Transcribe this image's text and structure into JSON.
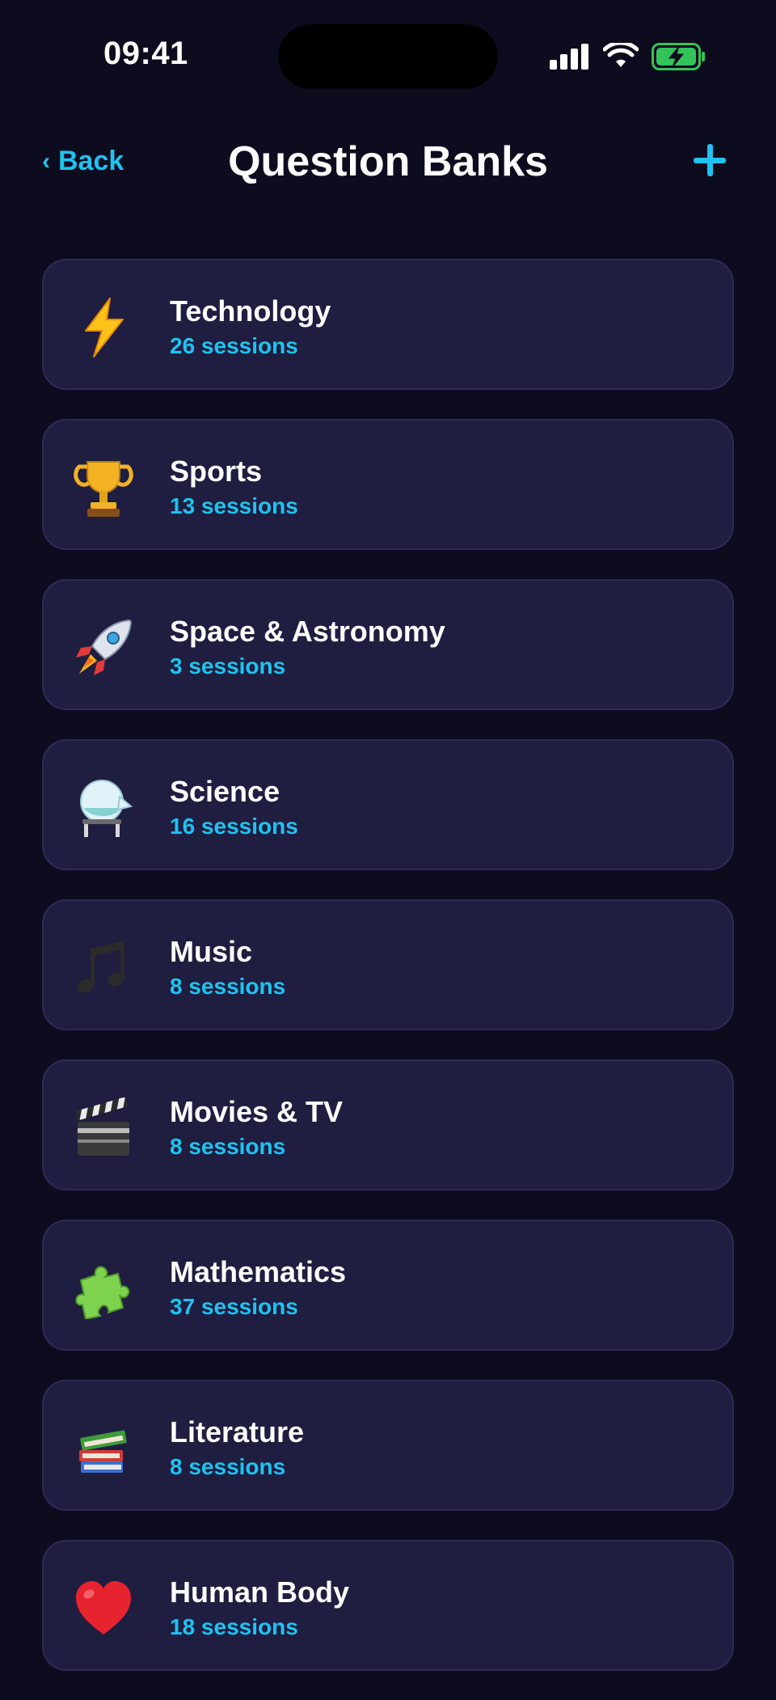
{
  "status_bar": {
    "time": "09:41"
  },
  "nav": {
    "back_label": "Back",
    "title": "Question Banks",
    "add_icon": "plus-icon"
  },
  "colors": {
    "background": "#0d0c1f",
    "card": "#1f1e40",
    "accent": "#1ec3f0"
  },
  "categories": [
    {
      "icon": "lightning-icon",
      "title": "Technology",
      "subtitle": "26 sessions"
    },
    {
      "icon": "trophy-icon",
      "title": "Sports",
      "subtitle": "13 sessions"
    },
    {
      "icon": "rocket-icon",
      "title": "Space & Astronomy",
      "subtitle": "3 sessions"
    },
    {
      "icon": "crystal-ball-icon",
      "title": "Science",
      "subtitle": "16 sessions"
    },
    {
      "icon": "music-notes-icon",
      "title": "Music",
      "subtitle": "8 sessions"
    },
    {
      "icon": "clapperboard-icon",
      "title": "Movies & TV",
      "subtitle": "8 sessions"
    },
    {
      "icon": "puzzle-icon",
      "title": "Mathematics",
      "subtitle": "37 sessions"
    },
    {
      "icon": "books-icon",
      "title": "Literature",
      "subtitle": "8 sessions"
    },
    {
      "icon": "heart-icon",
      "title": "Human Body",
      "subtitle": "18 sessions"
    }
  ]
}
